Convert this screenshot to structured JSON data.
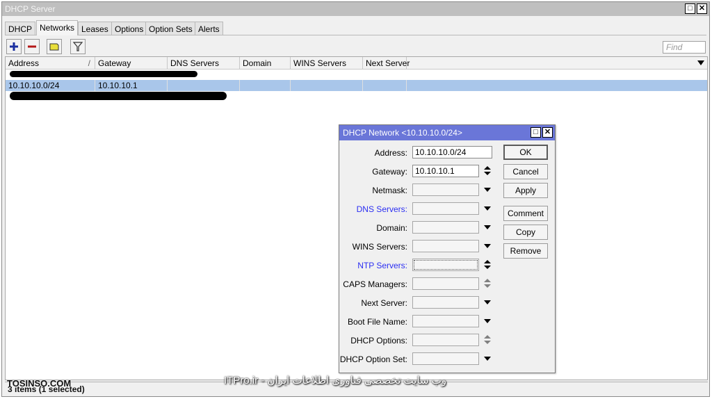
{
  "window": {
    "title": "DHCP Server"
  },
  "tabs": [
    "DHCP",
    "Networks",
    "Leases",
    "Options",
    "Option Sets",
    "Alerts"
  ],
  "toolbar": {
    "add_icon": "plus-icon",
    "remove_icon": "minus-icon",
    "comment_icon": "note-icon",
    "filter_icon": "filter-icon",
    "find_placeholder": "Find"
  },
  "table": {
    "columns": [
      "Address",
      "Gateway",
      "DNS Servers",
      "Domain",
      "WINS Servers",
      "Next Server"
    ],
    "rows": [
      {
        "address": "10.10.10.0/24",
        "gateway": "10.10.10.1"
      }
    ]
  },
  "status": "3 items (1 selected)",
  "watermarks": {
    "left": "TOSINSO.COM",
    "right": "ITPro.ir - وب سایت تخصصی فناوری اطلاعات ایران"
  },
  "dialog": {
    "title": "DHCP Network <10.10.10.0/24>",
    "fields": [
      {
        "label": "Address:",
        "value": "10.10.10.0/24"
      },
      {
        "label": "Gateway:",
        "value": "10.10.10.1"
      },
      {
        "label": "Netmask:",
        "value": ""
      },
      {
        "label": "DNS Servers:",
        "value": ""
      },
      {
        "label": "Domain:",
        "value": ""
      },
      {
        "label": "WINS Servers:",
        "value": ""
      },
      {
        "label": "NTP Servers:",
        "value": ""
      },
      {
        "label": "CAPS Managers:",
        "value": ""
      },
      {
        "label": "Next Server:",
        "value": ""
      },
      {
        "label": "Boot File Name:",
        "value": ""
      },
      {
        "label": "DHCP Options:",
        "value": ""
      },
      {
        "label": "DHCP Option Set:",
        "value": ""
      }
    ],
    "buttons": [
      "OK",
      "Cancel",
      "Apply",
      "Comment",
      "Copy",
      "Remove"
    ]
  },
  "colors": {
    "dialog_titlebar": "#6a76d8",
    "selected_row": "#a9c6ea",
    "link_label": "#2b2ef2"
  }
}
